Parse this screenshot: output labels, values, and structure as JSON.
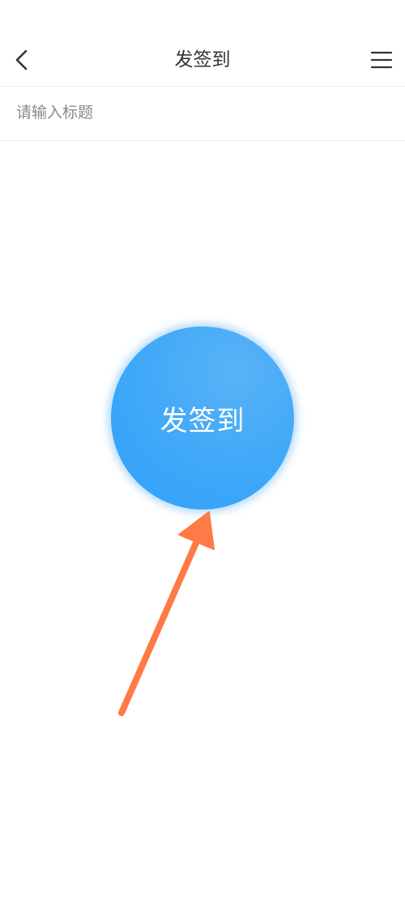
{
  "header": {
    "title": "发签到",
    "back_icon": "chevron-left-icon",
    "menu_icon": "menu-icon"
  },
  "form": {
    "title_placeholder": "请输入标题",
    "title_value": ""
  },
  "sign_button": {
    "label": "发签到",
    "color": "#3fa8f8"
  },
  "annotation": {
    "arrow_icon": "arrow-icon",
    "color": "#ff7a45"
  }
}
